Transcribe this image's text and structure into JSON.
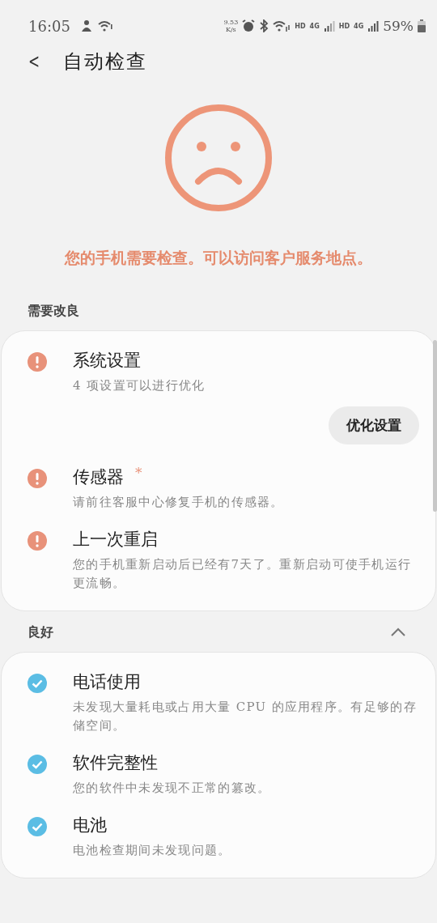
{
  "status_bar": {
    "time": "16:05",
    "net_speed_value": "9.53",
    "net_speed_unit": "K/s",
    "sim1_hd": "HD",
    "sim1_net": "4G",
    "sim2_hd": "HD",
    "sim2_net": "4G",
    "battery": "59%"
  },
  "header": {
    "back": "<",
    "title": "自动检查"
  },
  "result": {
    "kind": "sad",
    "message": "您的手机需要检查。可以访问客户服务地点。"
  },
  "sections": [
    {
      "title": "需要改良",
      "items": [
        {
          "kind": "warning",
          "title": "系统设置",
          "subtitle": "4 项设置可以进行优化",
          "button": "优化设置"
        },
        {
          "kind": "warning",
          "title": "传感器",
          "mark": "*",
          "subtitle": "请前往客服中心修复手机的传感器。"
        },
        {
          "kind": "warning",
          "title": "上一次重启",
          "subtitle": "您的手机重新启动后已经有7天了。重新启动可使手机运行更流畅。"
        }
      ]
    },
    {
      "title": "良好",
      "expanded": true,
      "items": [
        {
          "kind": "ok",
          "title": "电话使用",
          "subtitle": "未发现大量耗电或占用大量 CPU 的应用程序。有足够的存储空间。"
        },
        {
          "kind": "ok",
          "title": "软件完整性",
          "subtitle": "您的软件中未发现不正常的篡改。"
        },
        {
          "kind": "ok",
          "title": "电池",
          "subtitle": "电池检查期间未发现问题。"
        }
      ]
    }
  ]
}
